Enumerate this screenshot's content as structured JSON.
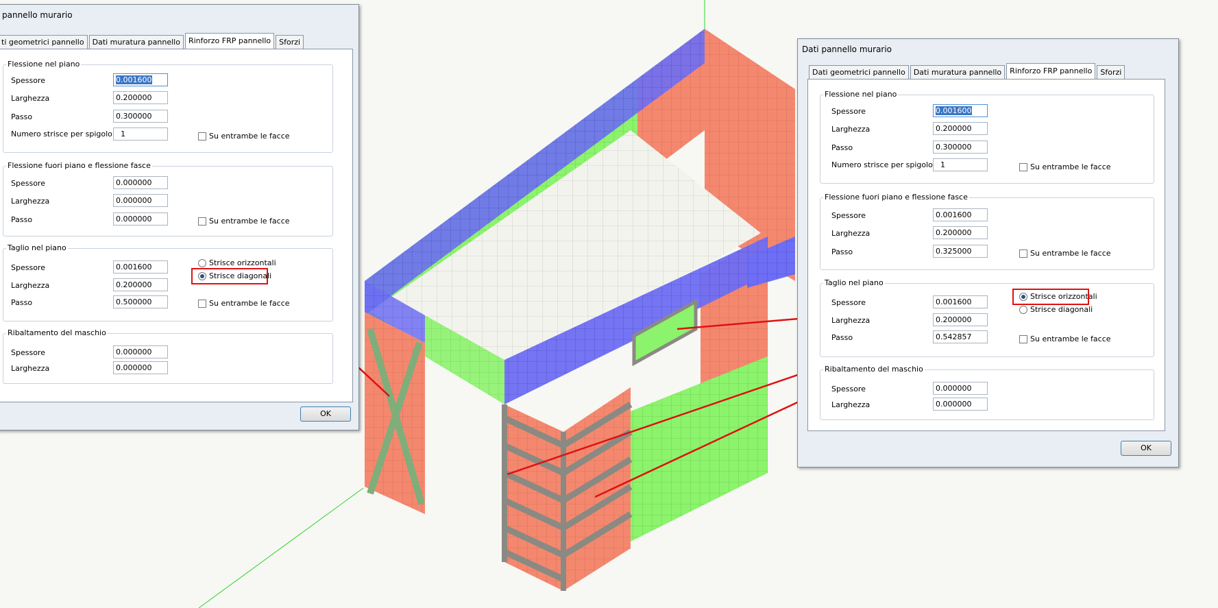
{
  "left_dialog": {
    "title": "pannello murario",
    "tabs": [
      "ti geometrici pannello",
      "Dati muratura pannello",
      "Rinforzo FRP pannello",
      "Sforzi"
    ],
    "active_tab": 2,
    "group1": {
      "title": "Flessione nel piano",
      "spessore_label": "Spessore",
      "spessore": "0.001600",
      "larghezza_label": "Larghezza",
      "larghezza": "0.200000",
      "passo_label": "Passo",
      "passo": "0.300000",
      "numero_label": "Numero strisce per spigolo",
      "numero": "1",
      "entrambe": "Su entrambe le facce"
    },
    "group2": {
      "title": "Flessione fuori piano e flessione fasce",
      "spessore_label": "Spessore",
      "spessore": "0.000000",
      "larghezza_label": "Larghezza",
      "larghezza": "0.000000",
      "passo_label": "Passo",
      "passo": "0.000000",
      "entrambe": "Su entrambe le facce"
    },
    "group3": {
      "title": "Taglio nel piano",
      "spessore_label": "Spessore",
      "spessore": "0.001600",
      "larghezza_label": "Larghezza",
      "larghezza": "0.200000",
      "passo_label": "Passo",
      "passo": "0.500000",
      "radio1": "Strisce orizzontali",
      "radio2": "Strisce diagonali",
      "entrambe": "Su entrambe le facce"
    },
    "group4": {
      "title": "Ribaltamento del maschio",
      "spessore_label": "Spessore",
      "spessore": "0.000000",
      "larghezza_label": "Larghezza",
      "larghezza": "0.000000"
    },
    "ok": "OK"
  },
  "right_dialog": {
    "title": "Dati pannello murario",
    "tabs": [
      "Dati geometrici pannello",
      "Dati muratura pannello",
      "Rinforzo FRP pannello",
      "Sforzi"
    ],
    "active_tab": 2,
    "group1": {
      "title": "Flessione nel piano",
      "spessore_label": "Spessore",
      "spessore": "0.001600",
      "larghezza_label": "Larghezza",
      "larghezza": "0.200000",
      "passo_label": "Passo",
      "passo": "0.300000",
      "numero_label": "Numero strisce per spigolo",
      "numero": "1",
      "entrambe": "Su entrambe le facce"
    },
    "group2": {
      "title": "Flessione fuori piano e flessione fasce",
      "spessore_label": "Spessore",
      "spessore": "0.001600",
      "larghezza_label": "Larghezza",
      "larghezza": "0.200000",
      "passo_label": "Passo",
      "passo": "0.325000",
      "entrambe": "Su entrambe le facce"
    },
    "group3": {
      "title": "Taglio nel piano",
      "spessore_label": "Spessore",
      "spessore": "0.001600",
      "larghezza_label": "Larghezza",
      "larghezza": "0.200000",
      "passo_label": "Passo",
      "passo": "0.542857",
      "radio1": "Strisce orizzontali",
      "radio2": "Strisce diagonali",
      "entrambe": "Su entrambe le facce"
    },
    "group4": {
      "title": "Ribaltamento del maschio",
      "spessore_label": "Spessore",
      "spessore": "0.000000",
      "larghezza_label": "Larghezza",
      "larghezza": "0.000000"
    },
    "ok": "OK"
  },
  "colors": {
    "frp_red": "#f4826a",
    "frp_green": "#8cf36c",
    "frp_blue": "#6a6af6",
    "slab": "#f3f3ee",
    "strip_gray": "#8a8a82",
    "annotation": "#e01010"
  }
}
